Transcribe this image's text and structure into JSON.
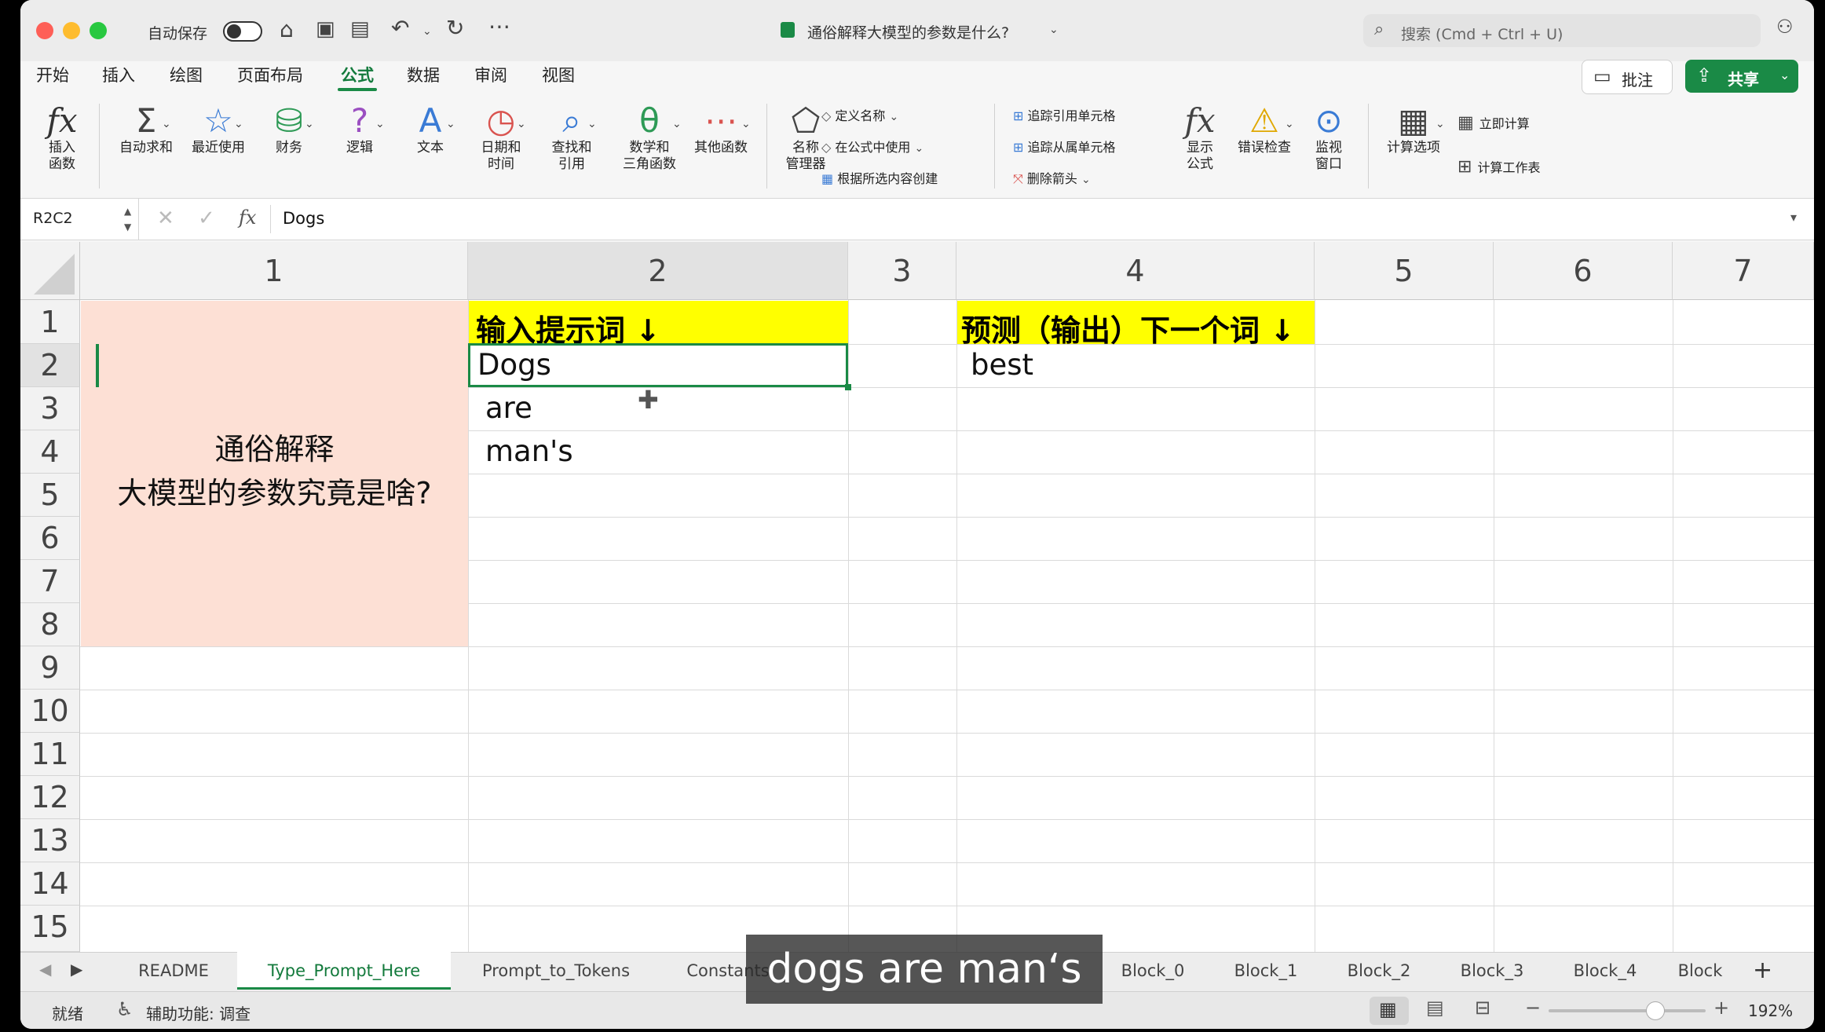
{
  "titlebar": {
    "autosave_label": "自动保存",
    "doc_title": "通俗解释大模型的参数是什么?",
    "search_placeholder": "搜索 (Cmd + Ctrl + U)"
  },
  "menu": [
    "开始",
    "插入",
    "绘图",
    "页面布局",
    "公式",
    "数据",
    "审阅",
    "视图"
  ],
  "menu_active": "公式",
  "buttons": {
    "comment": "批注",
    "share": "共享"
  },
  "ribbon": {
    "insert_function": "插入\n函数",
    "autosum": "自动求和",
    "recent": "最近使用",
    "financial": "财务",
    "logical": "逻辑",
    "text": "文本",
    "datetime": "日期和\n时间",
    "lookup": "查找和\n引用",
    "math": "数学和\n三角函数",
    "other": "其他函数",
    "name_manager": "名称\n管理器",
    "define_name": "定义名称",
    "use_in_formula": "在公式中使用",
    "create_from_selection": "根据所选内容创建",
    "trace_precedents": "追踪引用单元格",
    "trace_dependents": "追踪从属单元格",
    "remove_arrows": "删除箭头",
    "show_formulas": "显示\n公式",
    "error_checking": "错误检查",
    "watch_window": "监视\n窗口",
    "calc_options": "计算选项",
    "calc_now": "立即计算",
    "calc_sheet": "计算工作表"
  },
  "formula_bar": {
    "name_box": "R2C2",
    "fx": "fx",
    "content": "Dogs"
  },
  "columns": [
    "1",
    "2",
    "3",
    "4",
    "5",
    "6",
    "7"
  ],
  "rows": [
    "1",
    "2",
    "3",
    "4",
    "5",
    "6",
    "7",
    "8",
    "9",
    "10",
    "11",
    "12",
    "13",
    "14",
    "15"
  ],
  "cells": {
    "b1": "输入提示词 ↓",
    "d1": "预测（输出）下一个词 ↓",
    "b2": "Dogs",
    "d2": "best",
    "b3": "are",
    "b4": "man's",
    "merged_line1": "通俗解释",
    "merged_line2": "大模型的参数究竟是啥?"
  },
  "sheet_tabs": [
    "README",
    "Type_Prompt_Here",
    "Prompt_to_Tokens",
    "Constants",
    "Block_0",
    "Block_1",
    "Block_2",
    "Block_3",
    "Block_4",
    "Block"
  ],
  "active_tab": "Type_Prompt_Here",
  "status": {
    "ready": "就绪",
    "accessibility": "辅助功能: 调查",
    "zoom": "192%"
  },
  "subtitle": "dogs are man‘s",
  "colors": {
    "accent": "#1a8a46",
    "highlight": "#ffff00",
    "merged_fill": "#fde0d5"
  }
}
